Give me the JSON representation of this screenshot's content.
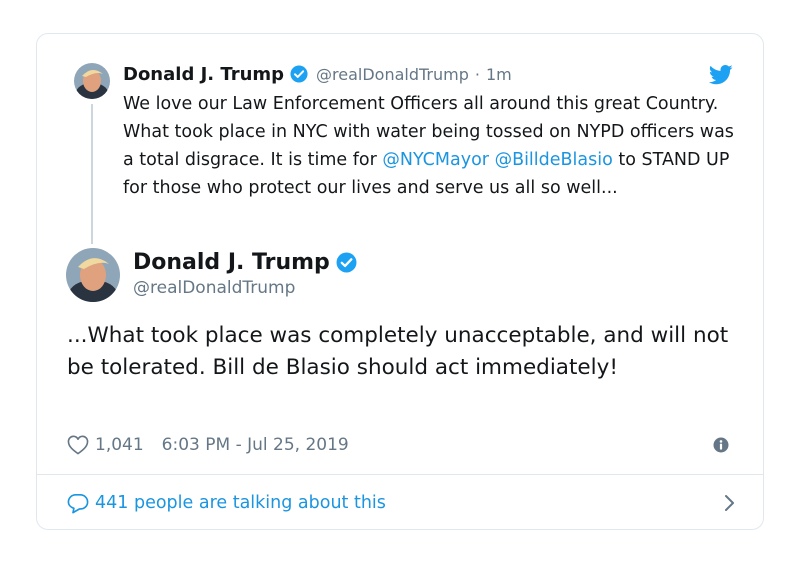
{
  "colors": {
    "accent": "#1b95e0",
    "text": "#14171a",
    "secondary": "#657786",
    "border": "#e1e8ed",
    "twitter_blue": "#1da1f2"
  },
  "parent_tweet": {
    "name": "Donald J. Trump",
    "handle": "@realDonaldTrump",
    "separator": "·",
    "time": "1m",
    "text_before": "We love our Law Enforcement Officers all around this great Country. What took place in NYC with water being tossed on NYPD officers was a total disgrace. It is time for ",
    "mention_1": "@NYCMayor",
    "mention_2": "@BilldeBlasio",
    "text_after": " to STAND UP for those who protect our lives and serve us all so well...",
    "icons": [
      "avatar",
      "verified-badge-icon",
      "twitter-bird-icon"
    ]
  },
  "main_tweet": {
    "name": "Donald J. Trump",
    "handle": "@realDonaldTrump",
    "text": "...What took place was completely unacceptable, and will not be tolerated. Bill de Blasio should act immediately!",
    "like_count": "1,041",
    "timestamp": "6:03 PM - Jul 25, 2019",
    "icons": [
      "avatar",
      "verified-badge-icon",
      "heart-icon",
      "info-icon"
    ]
  },
  "footer": {
    "talk_text": "441 people are talking about this",
    "icons": [
      "speech-bubble-icon",
      "chevron-right-icon"
    ]
  }
}
